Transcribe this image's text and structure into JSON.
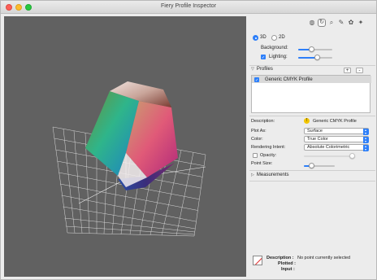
{
  "window": {
    "title": "Fiery Profile Inspector"
  },
  "toolbar": {
    "tools": [
      {
        "icon": "color-wheel-icon"
      },
      {
        "icon": "rotate-icon"
      },
      {
        "icon": "zoom-icon"
      },
      {
        "icon": "eyedropper-icon"
      },
      {
        "icon": "palette-icon"
      },
      {
        "icon": "wand-icon"
      }
    ]
  },
  "view": {
    "mode_3d_label": "3D",
    "mode_2d_label": "2D",
    "selected_mode": "3D",
    "background_label": "Background:",
    "background_level": 0.4,
    "lighting_label": "Lighting:",
    "lighting_checked": true,
    "lighting_level": 0.55
  },
  "profiles": {
    "section_label": "Profiles",
    "add_label": "+",
    "remove_label": "-",
    "items": [
      {
        "name": "Generic CMYK Profile",
        "checked": true
      }
    ]
  },
  "properties": {
    "description_label": "Description:",
    "description_value": "Generic CMYK Profile",
    "plot_as_label": "Plot As:",
    "plot_as_value": "Surface",
    "color_label": "Color:",
    "color_value": "True Color",
    "rendering_intent_label": "Rendering Intent:",
    "rendering_intent_value": "Absolute Colorimetric",
    "opacity_label": "Opacity:",
    "opacity_checked": false,
    "point_size_label": "Point Size:",
    "point_size_level": 0.2
  },
  "measurements": {
    "section_label": "Measurements"
  },
  "selection_info": {
    "description_label": "Description :",
    "description_value": "No point currently selected",
    "plotted_label": "Plotted :",
    "input_label": "Input :"
  },
  "colors": {
    "accent": "#2d7ff9",
    "viewport_bg": "#616161",
    "close": "#fc5f57",
    "minimize": "#fdbc2e",
    "maximize": "#28c840"
  }
}
